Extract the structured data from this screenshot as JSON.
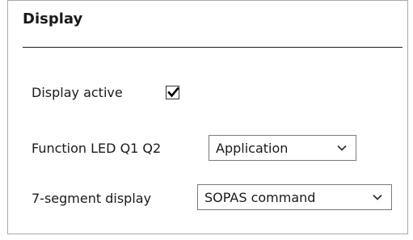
{
  "panel": {
    "title": "Display"
  },
  "fields": {
    "display_active_label": "Display active",
    "display_active_checked": true,
    "function_led_label": "Function LED Q1 Q2",
    "function_led_value": "Application",
    "seven_segment_label": "7-segment display",
    "seven_segment_value": "SOPAS command"
  },
  "icons": {
    "checkbox": "checkmark-icon",
    "dropdown": "chevron-down-icon"
  }
}
